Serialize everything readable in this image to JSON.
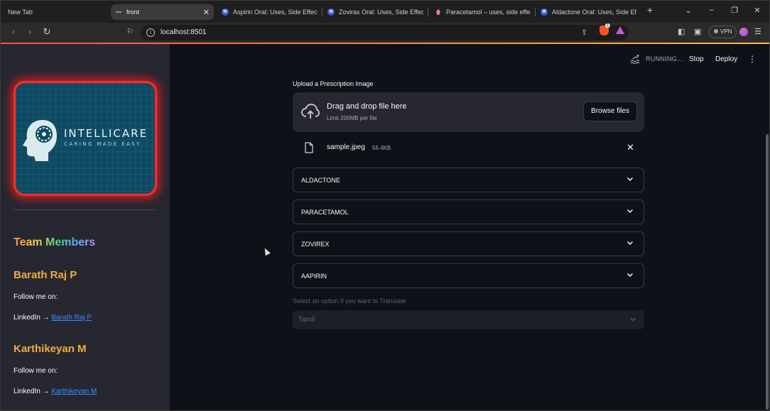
{
  "browser": {
    "tabs": [
      {
        "label": "New Tab"
      },
      {
        "label": "front"
      },
      {
        "label": "Aspirin Oral: Uses, Side Effects, I"
      },
      {
        "label": "Zovirax Oral: Uses, Side Effects,"
      },
      {
        "label": "Paracetamol – uses, side effects"
      },
      {
        "label": "Aldactone Oral: Uses, Side Effe"
      }
    ],
    "url": "localhost:8501",
    "brave_badge": "1",
    "vpn_label": "VPN"
  },
  "app_header": {
    "status": "RUNNING...",
    "stop_label": "Stop",
    "deploy_label": "Deploy"
  },
  "sidebar": {
    "logo": {
      "brand": "INTELLICARE",
      "tagline": "CARING MADE EASY"
    },
    "team_title": "Team Members",
    "members": [
      {
        "name": "Barath Raj P",
        "follow": "Follow me on:",
        "link_prefix": "LinkedIn → ",
        "link_text": "Barath Raj P"
      },
      {
        "name": "Karthikeyan M",
        "follow": "Follow me on:",
        "link_prefix": "LinkedIn → ",
        "link_text": "Karthikeyan M"
      }
    ]
  },
  "main": {
    "upload": {
      "label": "Upload a Prescription Image",
      "drop_title": "Drag and drop file here",
      "limit": "Limit 200MB per file",
      "browse_label": "Browse files"
    },
    "file": {
      "name": "sample.jpeg",
      "size": "56.4KB"
    },
    "expanders": [
      {
        "label": "ALDACTONE"
      },
      {
        "label": "PARACETAMOL"
      },
      {
        "label": "ZOVIREX"
      },
      {
        "label": "AAPIRIN"
      }
    ],
    "translate": {
      "label": "Select an option if you want to Translate",
      "selected": "Tamil"
    }
  },
  "colors": {
    "accent_red": "#ff2b2b",
    "member_name": "#f0ad3e",
    "link": "#3b8cff",
    "background": "#0e1117",
    "sidebar_bg": "#262730"
  }
}
